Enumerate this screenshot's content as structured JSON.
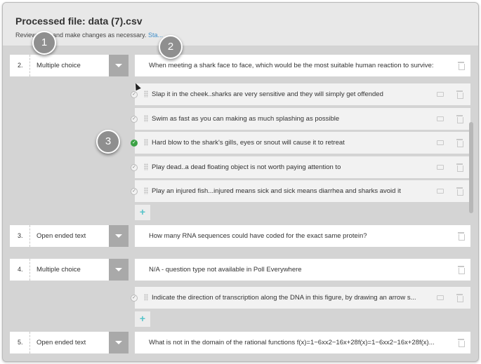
{
  "header": {
    "title": "Processed file: data (7).csv",
    "subtitle": "Review polls and make changes as necessary.",
    "link": "Sta..."
  },
  "questions": [
    {
      "num": "2.",
      "type": "Multiple choice",
      "text": "When meeting a shark face to face, which would be the most suitable human reaction to survive:"
    },
    {
      "num": "3.",
      "type": "Open ended text",
      "text": "How many RNA sequences could have coded for the exact same protein?"
    },
    {
      "num": "4.",
      "type": "Multiple choice",
      "text": "N/A - question type not available in Poll Everywhere"
    },
    {
      "num": "5.",
      "type": "Open ended text",
      "text": "What is not in the domain of the rational functions f(x)=1−6xx2−16x+28f(x)=1−6xx2−16x+28f(x)..."
    }
  ],
  "answers_q2": [
    {
      "text": "Slap it in the cheek..sharks are very sensitive and they will simply get offended",
      "correct": false
    },
    {
      "text": "Swim as fast as you can making as much splashing as possible",
      "correct": false
    },
    {
      "text": "Hard blow to the shark's gills, eyes or snout will cause it to retreat",
      "correct": true
    },
    {
      "text": "Play dead..a dead floating object is not worth paying attention to",
      "correct": false
    },
    {
      "text": "Play an injured fish...injured means sick and sick means diarrhea and sharks avoid it",
      "correct": false
    }
  ],
  "answers_q4": [
    {
      "text": "Indicate the direction of transcription along the DNA in this figure, by drawing an arrow s...",
      "correct": false
    }
  ],
  "add_label": "+",
  "check_glyph": "✓",
  "callouts": [
    "1",
    "2",
    "3"
  ],
  "colors": {
    "accent": "#3f8ec9",
    "correct": "#3aa144",
    "add": "#56c3c9"
  }
}
